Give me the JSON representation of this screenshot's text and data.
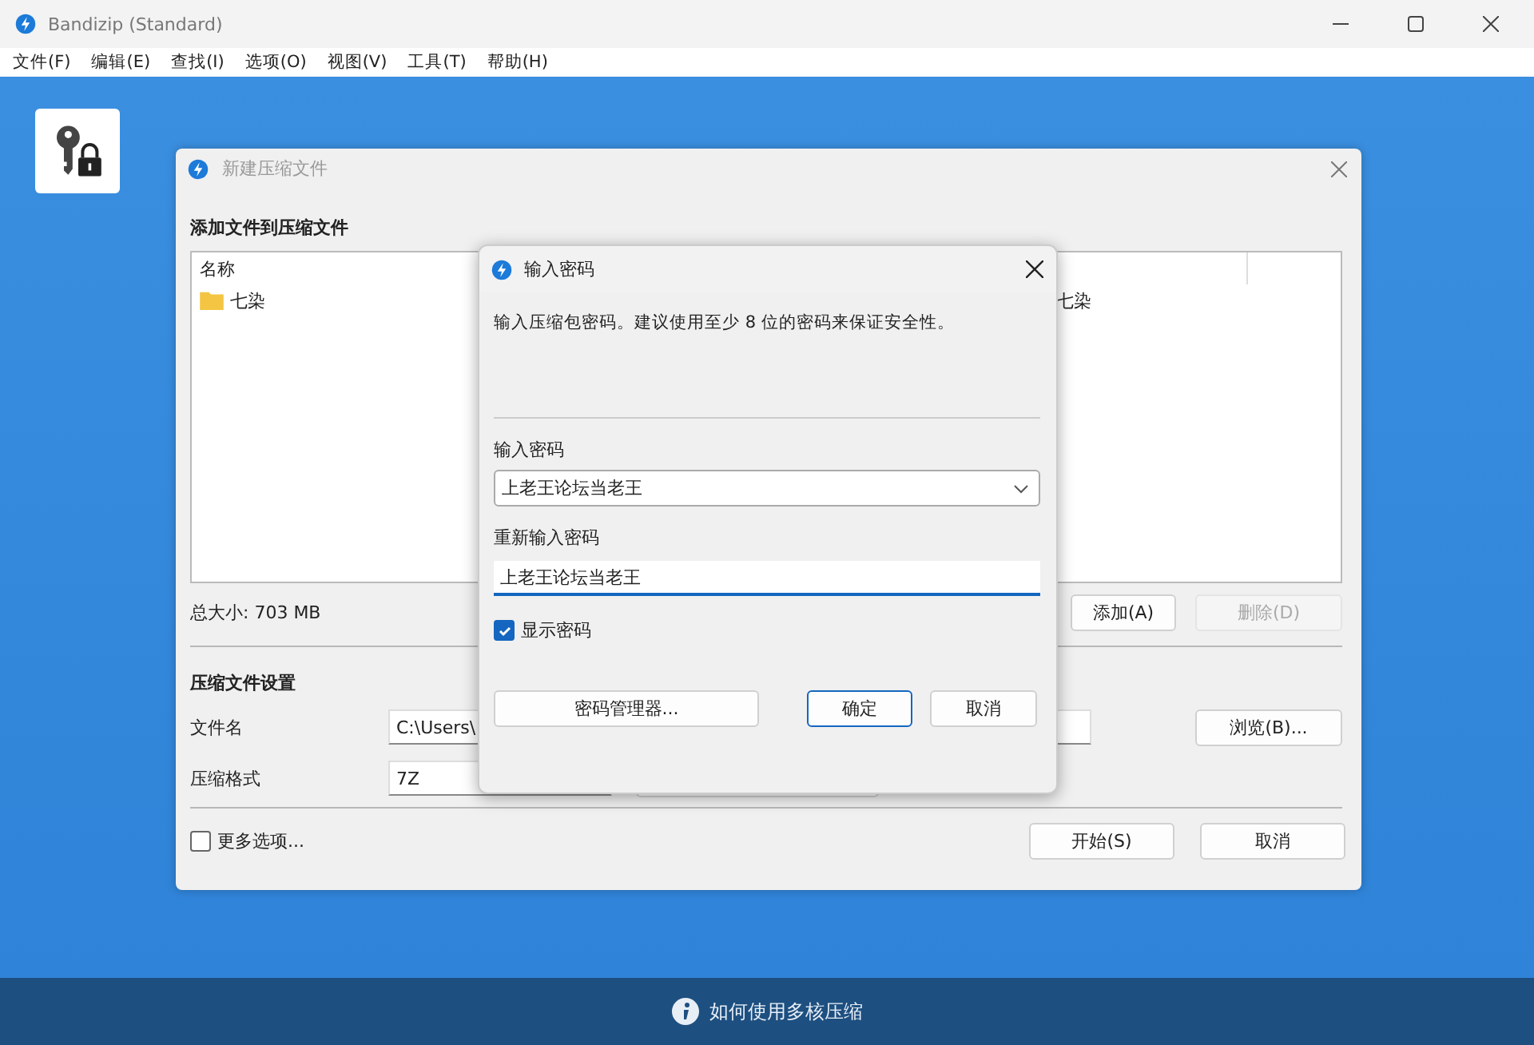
{
  "window": {
    "title": "Bandizip (Standard)"
  },
  "menu": [
    "文件(F)",
    "编辑(E)",
    "查找(I)",
    "选项(O)",
    "视图(V)",
    "工具(T)",
    "帮助(H)"
  ],
  "new_archive_dialog": {
    "title": "新建压缩文件",
    "section_title": "添加文件到压缩文件",
    "file_list": {
      "columns": [
        "名称"
      ],
      "rows": [
        {
          "name": "七染",
          "column_2": "七染"
        }
      ]
    },
    "total_size": "总大小: 703 MB",
    "buttons": [
      {
        "label": "添加(A)",
        "disabled": false
      },
      {
        "label": "删除(D)",
        "disabled": true
      }
    ],
    "settings_title": "压缩文件设置",
    "filename_label": "文件名",
    "filename_value": "C:\\Users\\",
    "browse_button": "浏览(B)...",
    "format_label": "压缩格式",
    "format_value": "7Z",
    "more_options": {
      "label": "更多选项...",
      "checked": false
    },
    "start_button": "开始(S)",
    "cancel_button": "取消"
  },
  "password_dialog": {
    "title": "输入密码",
    "description": "输入压缩包密码。建议使用至少 8 位的密码来保证安全性。",
    "password_label": "输入密码",
    "password_value": "上老王论坛当老王",
    "confirm_label": "重新输入密码",
    "confirm_value": "上老王论坛当老王",
    "show_password": {
      "label": "显示密码",
      "checked": true
    },
    "manager_button": "密码管理器...",
    "ok_button": "确定",
    "cancel_button": "取消"
  },
  "status_bar": {
    "text": "如何使用多核压缩"
  }
}
